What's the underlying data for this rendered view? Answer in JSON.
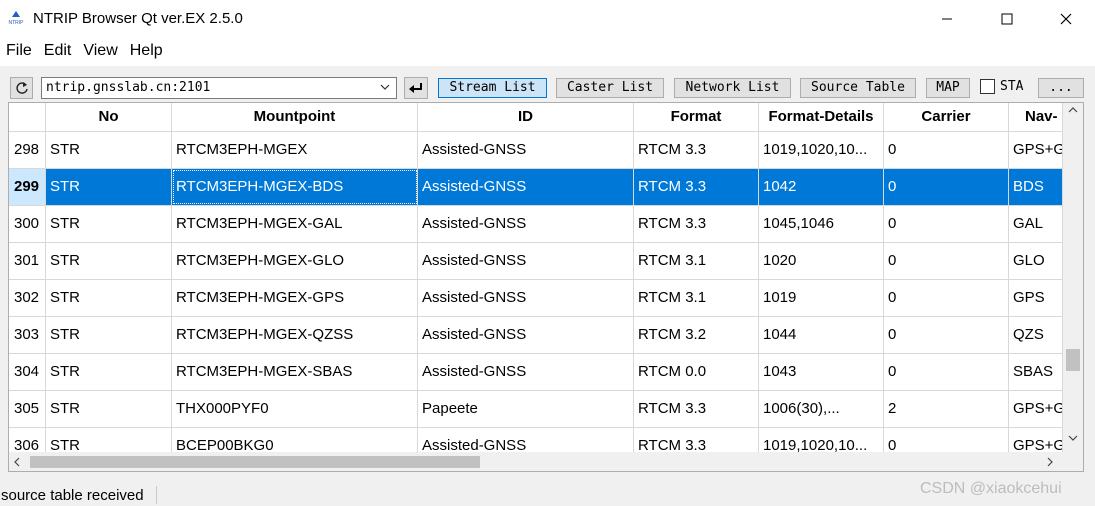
{
  "window": {
    "title": "NTRIP Browser Qt ver.EX 2.5.0",
    "icon_text": "NTRIP"
  },
  "menu": [
    "File",
    "Edit",
    "View",
    "Help"
  ],
  "toolbar": {
    "address": "ntrip.gnsslab.cn:2101",
    "buttons": [
      "Stream List",
      "Caster List",
      "Network List",
      "Source Table",
      "MAP"
    ],
    "active_button": "Stream List",
    "sta_label": "STA",
    "more_label": "...",
    "sta_checked": false
  },
  "table": {
    "columns": [
      "No",
      "Mountpoint",
      "ID",
      "Format",
      "Format-Details",
      "Carrier",
      "Nav-"
    ],
    "rows": [
      {
        "num": "298",
        "no": "STR",
        "mountpoint": "RTCM3EPH-MGEX",
        "id": "Assisted-GNSS",
        "format": "RTCM 3.3",
        "details": "1019,1020,10...",
        "carrier": "0",
        "nav": "GPS+G"
      },
      {
        "num": "299",
        "no": "STR",
        "mountpoint": "RTCM3EPH-MGEX-BDS",
        "id": "Assisted-GNSS",
        "format": "RTCM 3.3",
        "details": "1042",
        "carrier": "0",
        "nav": "BDS"
      },
      {
        "num": "300",
        "no": "STR",
        "mountpoint": "RTCM3EPH-MGEX-GAL",
        "id": "Assisted-GNSS",
        "format": "RTCM 3.3",
        "details": "1045,1046",
        "carrier": "0",
        "nav": "GAL"
      },
      {
        "num": "301",
        "no": "STR",
        "mountpoint": "RTCM3EPH-MGEX-GLO",
        "id": "Assisted-GNSS",
        "format": "RTCM 3.1",
        "details": "1020",
        "carrier": "0",
        "nav": "GLO"
      },
      {
        "num": "302",
        "no": "STR",
        "mountpoint": "RTCM3EPH-MGEX-GPS",
        "id": "Assisted-GNSS",
        "format": "RTCM 3.1",
        "details": "1019",
        "carrier": "0",
        "nav": "GPS"
      },
      {
        "num": "303",
        "no": "STR",
        "mountpoint": "RTCM3EPH-MGEX-QZSS",
        "id": "Assisted-GNSS",
        "format": "RTCM 3.2",
        "details": "1044",
        "carrier": "0",
        "nav": "QZS"
      },
      {
        "num": "304",
        "no": "STR",
        "mountpoint": "RTCM3EPH-MGEX-SBAS",
        "id": "Assisted-GNSS",
        "format": "RTCM 0.0",
        "details": "1043",
        "carrier": "0",
        "nav": "SBAS"
      },
      {
        "num": "305",
        "no": "STR",
        "mountpoint": "THX000PYF0",
        "id": "Papeete",
        "format": "RTCM 3.3",
        "details": "1006(30),...",
        "carrier": "2",
        "nav": "GPS+G"
      },
      {
        "num": "306",
        "no": "STR",
        "mountpoint": "BCEP00BKG0",
        "id": "Assisted-GNSS",
        "format": "RTCM 3.3",
        "details": "1019,1020,10...",
        "carrier": "0",
        "nav": "GPS+G"
      }
    ],
    "selected_row": "299"
  },
  "status": {
    "text": "source table received"
  },
  "watermark": "CSDN @xiaokcehui",
  "colors": {
    "selection": "#0078d7",
    "selected_rownum": "#cce8ff",
    "active_button": "#cce4f7"
  }
}
